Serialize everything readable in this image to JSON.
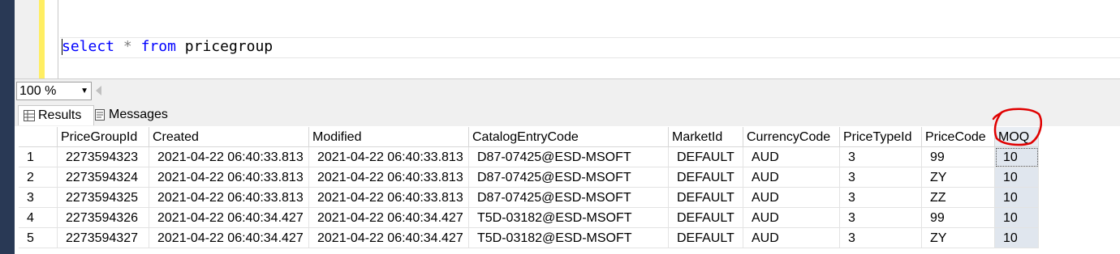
{
  "editor": {
    "query": {
      "keyword_select": "select",
      "star": "*",
      "keyword_from": "from",
      "table": "pricegroup"
    }
  },
  "zoom": {
    "value": "100 %"
  },
  "tabs": {
    "results": "Results",
    "messages": "Messages"
  },
  "grid": {
    "columns": [
      "PriceGroupId",
      "Created",
      "Modified",
      "CatalogEntryCode",
      "MarketId",
      "CurrencyCode",
      "PriceTypeId",
      "PriceCode",
      "MOQ"
    ],
    "rows": [
      {
        "num": "1",
        "cells": [
          "2273594323",
          "2021-04-22 06:40:33.813",
          "2021-04-22 06:40:33.813",
          "D87-07425@ESD-MSOFT",
          "DEFAULT",
          "AUD",
          "3",
          "99",
          "10"
        ]
      },
      {
        "num": "2",
        "cells": [
          "2273594324",
          "2021-04-22 06:40:33.813",
          "2021-04-22 06:40:33.813",
          "D87-07425@ESD-MSOFT",
          "DEFAULT",
          "AUD",
          "3",
          "ZY",
          "10"
        ]
      },
      {
        "num": "3",
        "cells": [
          "2273594325",
          "2021-04-22 06:40:33.813",
          "2021-04-22 06:40:33.813",
          "D87-07425@ESD-MSOFT",
          "DEFAULT",
          "AUD",
          "3",
          "ZZ",
          "10"
        ]
      },
      {
        "num": "4",
        "cells": [
          "2273594326",
          "2021-04-22 06:40:34.427",
          "2021-04-22 06:40:34.427",
          "T5D-03182@ESD-MSOFT",
          "DEFAULT",
          "AUD",
          "3",
          "99",
          "10"
        ]
      },
      {
        "num": "5",
        "cells": [
          "2273594327",
          "2021-04-22 06:40:34.427",
          "2021-04-22 06:40:34.427",
          "T5D-03182@ESD-MSOFT",
          "DEFAULT",
          "AUD",
          "3",
          "ZY",
          "10"
        ]
      }
    ]
  },
  "colors": {
    "keyword": "#0000ff",
    "annotation": "#e00000",
    "moq_highlight": "#e0e6ee"
  }
}
